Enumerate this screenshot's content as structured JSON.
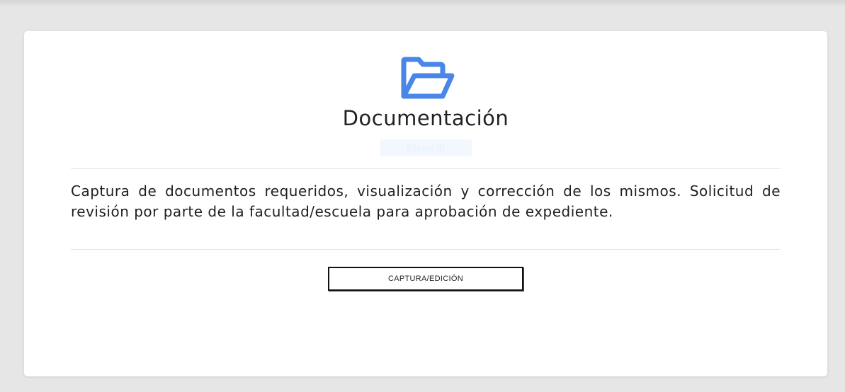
{
  "card": {
    "icon": "folder-open-icon",
    "title": "Documentación",
    "badge": "Etapa III",
    "description": "Captura de documentos requeridos, visualización y corrección de los mismos. Solicitud de revisión por parte de la facultad/escuela para aprobación de expediente.",
    "button_label": "CAPTURA/EDICIÓN"
  },
  "colors": {
    "icon": "#4a86e8",
    "badge_bg": "#f2f8fd",
    "button_border": "#111111"
  }
}
